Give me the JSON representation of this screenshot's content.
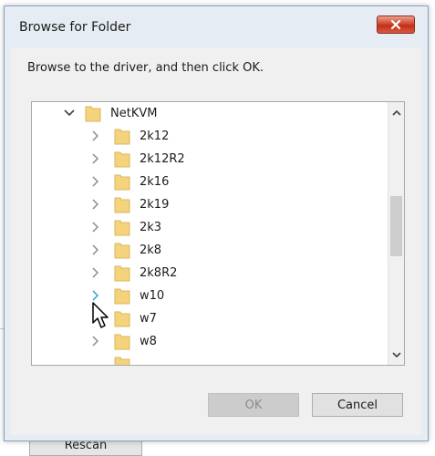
{
  "background": {
    "rescan_label": "Rescan"
  },
  "dialog": {
    "title": "Browse for Folder",
    "instruction": "Browse to the driver, and then click OK.",
    "tree": {
      "root": {
        "label": "NetKVM",
        "expanded": true
      },
      "children": [
        {
          "label": "2k12"
        },
        {
          "label": "2k12R2"
        },
        {
          "label": "2k16"
        },
        {
          "label": "2k19"
        },
        {
          "label": "2k3"
        },
        {
          "label": "2k8"
        },
        {
          "label": "2k8R2"
        },
        {
          "label": "w10"
        },
        {
          "label": "w7"
        },
        {
          "label": "w8"
        }
      ]
    },
    "buttons": {
      "ok_label": "OK",
      "ok_enabled": false,
      "cancel_label": "Cancel"
    }
  },
  "colors": {
    "close_button": "#c7412c",
    "folder": "#f4d37c",
    "frame": "#e6ecf3"
  }
}
